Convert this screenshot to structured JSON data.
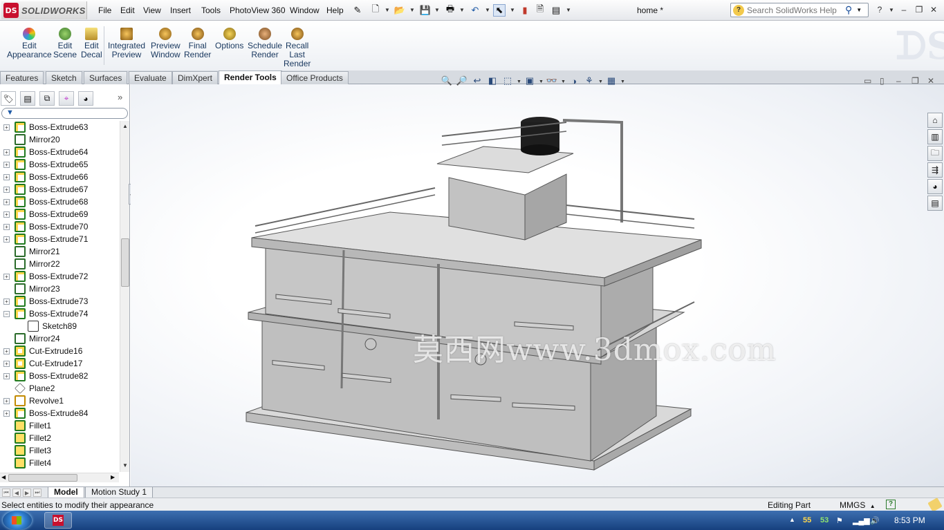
{
  "app": {
    "brand": "SOLIDWORKS",
    "document_title": "home *"
  },
  "menu": [
    "File",
    "Edit",
    "View",
    "Insert",
    "Tools",
    "PhotoView 360",
    "Window",
    "Help"
  ],
  "search": {
    "placeholder": "Search SolidWorks Help"
  },
  "command_manager": [
    {
      "label": "Edit\nAppearance",
      "icon": "appearance-icon",
      "color": "#c0392b"
    },
    {
      "label": "Edit\nScene",
      "icon": "scene-icon",
      "color": "#5a8f3d"
    },
    {
      "label": "Edit\nDecal",
      "icon": "decal-icon",
      "color": "#c7a23a"
    },
    {
      "label": "Integrated\nPreview",
      "icon": "integrated-preview-icon",
      "color": "#b8872f"
    },
    {
      "label": "Preview\nWindow",
      "icon": "preview-window-icon",
      "color": "#a67a2a"
    },
    {
      "label": "Final\nRender",
      "icon": "final-render-icon",
      "color": "#b07a20"
    },
    {
      "label": "Options",
      "icon": "options-icon",
      "color": "#a88a30"
    },
    {
      "label": "Schedule\nRender",
      "icon": "schedule-render-icon",
      "color": "#a07040"
    },
    {
      "label": "Recall\nLast\nRender",
      "icon": "recall-render-icon",
      "color": "#b07a30"
    }
  ],
  "tabs": [
    "Features",
    "Sketch",
    "Surfaces",
    "Evaluate",
    "DimXpert",
    "Render Tools",
    "Office Products"
  ],
  "active_tab": "Render Tools",
  "feature_tree": [
    {
      "label": "Boss-Extrude63",
      "type": "boss",
      "expanded": false
    },
    {
      "label": "Mirror20",
      "type": "mirror",
      "expanded": null
    },
    {
      "label": "Boss-Extrude64",
      "type": "boss",
      "expanded": false
    },
    {
      "label": "Boss-Extrude65",
      "type": "boss",
      "expanded": false
    },
    {
      "label": "Boss-Extrude66",
      "type": "boss",
      "expanded": false
    },
    {
      "label": "Boss-Extrude67",
      "type": "boss",
      "expanded": false
    },
    {
      "label": "Boss-Extrude68",
      "type": "boss",
      "expanded": false
    },
    {
      "label": "Boss-Extrude69",
      "type": "boss",
      "expanded": false
    },
    {
      "label": "Boss-Extrude70",
      "type": "boss",
      "expanded": false
    },
    {
      "label": "Boss-Extrude71",
      "type": "boss",
      "expanded": false
    },
    {
      "label": "Mirror21",
      "type": "mirror",
      "expanded": null
    },
    {
      "label": "Mirror22",
      "type": "mirror",
      "expanded": null
    },
    {
      "label": "Boss-Extrude72",
      "type": "boss",
      "expanded": false
    },
    {
      "label": "Mirror23",
      "type": "mirror",
      "expanded": null
    },
    {
      "label": "Boss-Extrude73",
      "type": "boss",
      "expanded": false
    },
    {
      "label": "Boss-Extrude74",
      "type": "boss",
      "expanded": true
    },
    {
      "label": "Sketch89",
      "type": "sketch",
      "expanded": null,
      "child": true
    },
    {
      "label": "Mirror24",
      "type": "mirror",
      "expanded": null
    },
    {
      "label": "Cut-Extrude16",
      "type": "cut",
      "expanded": false
    },
    {
      "label": "Cut-Extrude17",
      "type": "cut",
      "expanded": false
    },
    {
      "label": "Boss-Extrude82",
      "type": "boss",
      "expanded": false
    },
    {
      "label": "Plane2",
      "type": "plane",
      "expanded": null
    },
    {
      "label": "Revolve1",
      "type": "revolve",
      "expanded": false
    },
    {
      "label": "Boss-Extrude84",
      "type": "boss",
      "expanded": false
    },
    {
      "label": "Fillet1",
      "type": "fillet",
      "expanded": null
    },
    {
      "label": "Fillet2",
      "type": "fillet",
      "expanded": null
    },
    {
      "label": "Fillet3",
      "type": "fillet",
      "expanded": null
    },
    {
      "label": "Fillet4",
      "type": "fillet",
      "expanded": null
    }
  ],
  "viewport": {
    "watermark": "莫西网www.3dmox.com"
  },
  "bottom_tabs": [
    "Model",
    "Motion Study 1"
  ],
  "active_bottom_tab": "Model",
  "status": {
    "message": "Select entities to modify their appearance",
    "state": "Editing Part",
    "units": "MMGS",
    "help": "?"
  },
  "taskbar": {
    "tray_a": "55",
    "tray_b": "53",
    "clock": "8:53 PM"
  }
}
